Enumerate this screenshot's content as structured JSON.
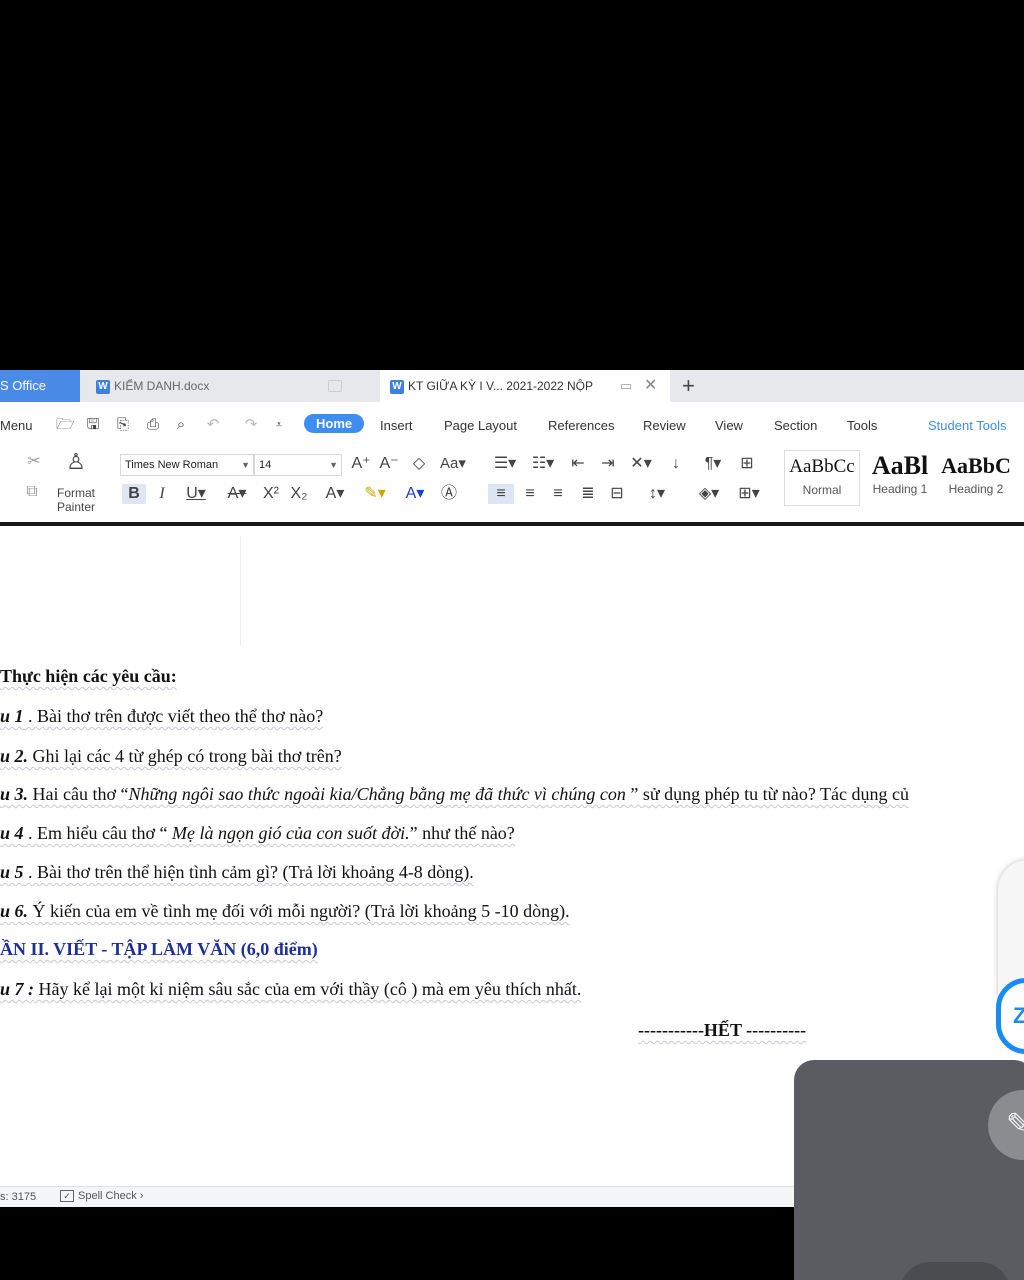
{
  "tabbar": {
    "brand": "S Office",
    "tabs": [
      {
        "label": "KIỂM DANH.docx"
      },
      {
        "label": "KT GIỮA KỲ I V... 2021-2022 NỘP"
      }
    ],
    "new_tab": "+"
  },
  "menu": {
    "menu_label": "Menu",
    "items": [
      "Home",
      "Insert",
      "Page Layout",
      "References",
      "Review",
      "View",
      "Section",
      "Tools",
      "Student Tools"
    ]
  },
  "ribbon": {
    "format_painter": "Format Painter",
    "font_name": "Times New Roman",
    "font_size": "14",
    "styles": [
      {
        "sample": "AaBbCc",
        "name": "Normal"
      },
      {
        "sample": "AaBl",
        "name": "Heading 1"
      },
      {
        "sample": "AaBbC",
        "name": "Heading 2"
      }
    ]
  },
  "document": {
    "requirements": "Thực hiện các yêu cầu:",
    "questions": [
      {
        "label": "u 1",
        "text": " . Bài thơ trên được viết theo thể thơ nào?"
      },
      {
        "label": "u 2.",
        "text": " Ghi lại các 4 từ ghép có trong bài  thơ trên?"
      },
      {
        "label": "u 3.",
        "text_before": " Hai câu thơ “",
        "quote": "Những ngôi sao thức ngoài kia/Chẳng bằng mẹ đã thức vì chúng con",
        "text_after": " ” sử dụng phép tu từ nào? Tác dụng củ"
      },
      {
        "label": "u 4",
        "text_before": " . Em hiểu câu thơ “ ",
        "quote": "Mẹ là ngọn gió của con suốt đời.",
        "text_after": "” như thế nào?"
      },
      {
        "label": "u 5",
        "text": " . Bài thơ trên thể  hiện tình cảm gì? (Trả lời khoảng 4-8 dòng)."
      },
      {
        "label": "u 6.",
        "text": " Ý kiến của em về tình mẹ đối với mỗi người? (Trả lời khoảng 5 -10 dòng)."
      }
    ],
    "part2": "ẦN II. VIẾT - TẬP LÀM VĂN (6,0 điểm)",
    "q7": {
      "label": "u 7 :",
      "text": "   Hãy kể lại một kỉ  niệm sâu sắc  của em với thầy  (cô ) mà em yêu thích nhất."
    },
    "end": "-----------HẾT ----------"
  },
  "status": {
    "word_count": "s: 3175",
    "spell_check": "Spell Check"
  },
  "overlay": {
    "zalo_letter": "Z"
  },
  "colors": {
    "accent": "#3e8ef2",
    "part_heading": "#1f2f9a"
  }
}
